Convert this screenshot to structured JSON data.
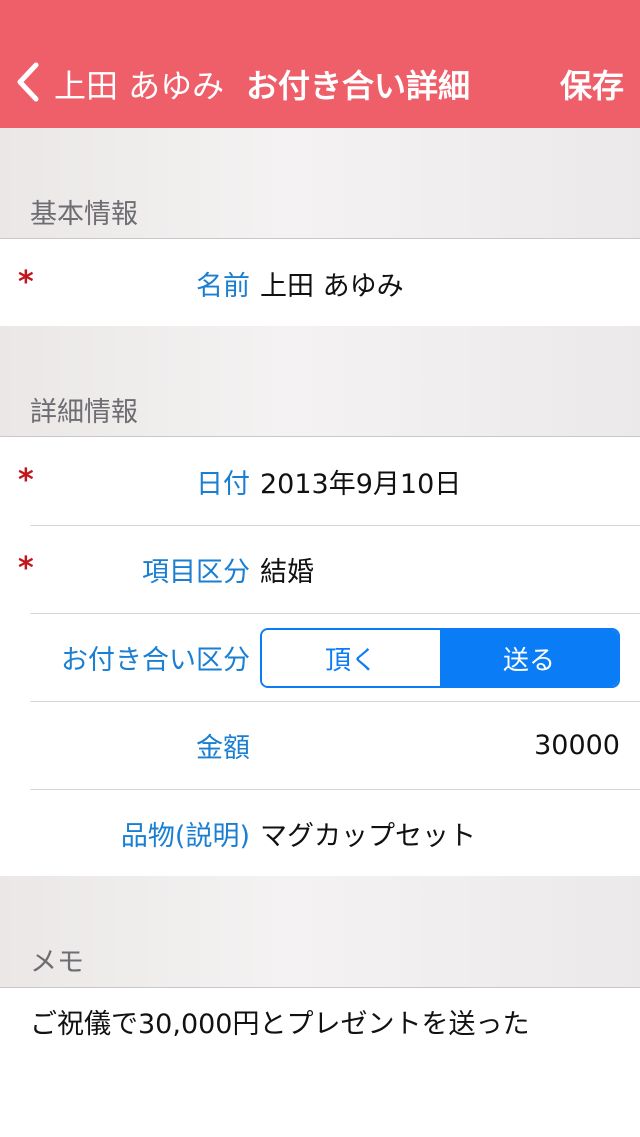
{
  "nav": {
    "back_label": "上田 あゆみ",
    "title": "お付き合い詳細",
    "save_label": "保存"
  },
  "basic": {
    "header": "基本情報",
    "name_label": "名前",
    "name_value": "上田 あゆみ"
  },
  "detail": {
    "header": "詳細情報",
    "date_label": "日付",
    "date_value": "2013年9月10日",
    "category_label": "項目区分",
    "category_value": "結婚",
    "relation_label": "お付き合い区分",
    "relation_options": [
      "頂く",
      "送る"
    ],
    "relation_selected": "送る",
    "amount_label": "金額",
    "amount_value": "30000",
    "item_label": "品物(説明)",
    "item_value": "マグカップセット"
  },
  "memo": {
    "header": "メモ",
    "text": "ご祝儀で30,000円とプレゼントを送った"
  },
  "required_mark": "*",
  "colors": {
    "navbar": "#ee5f6a",
    "label_blue": "#1a7fd2",
    "segment_blue": "#0a7cf5",
    "required_red": "#c0161c"
  }
}
